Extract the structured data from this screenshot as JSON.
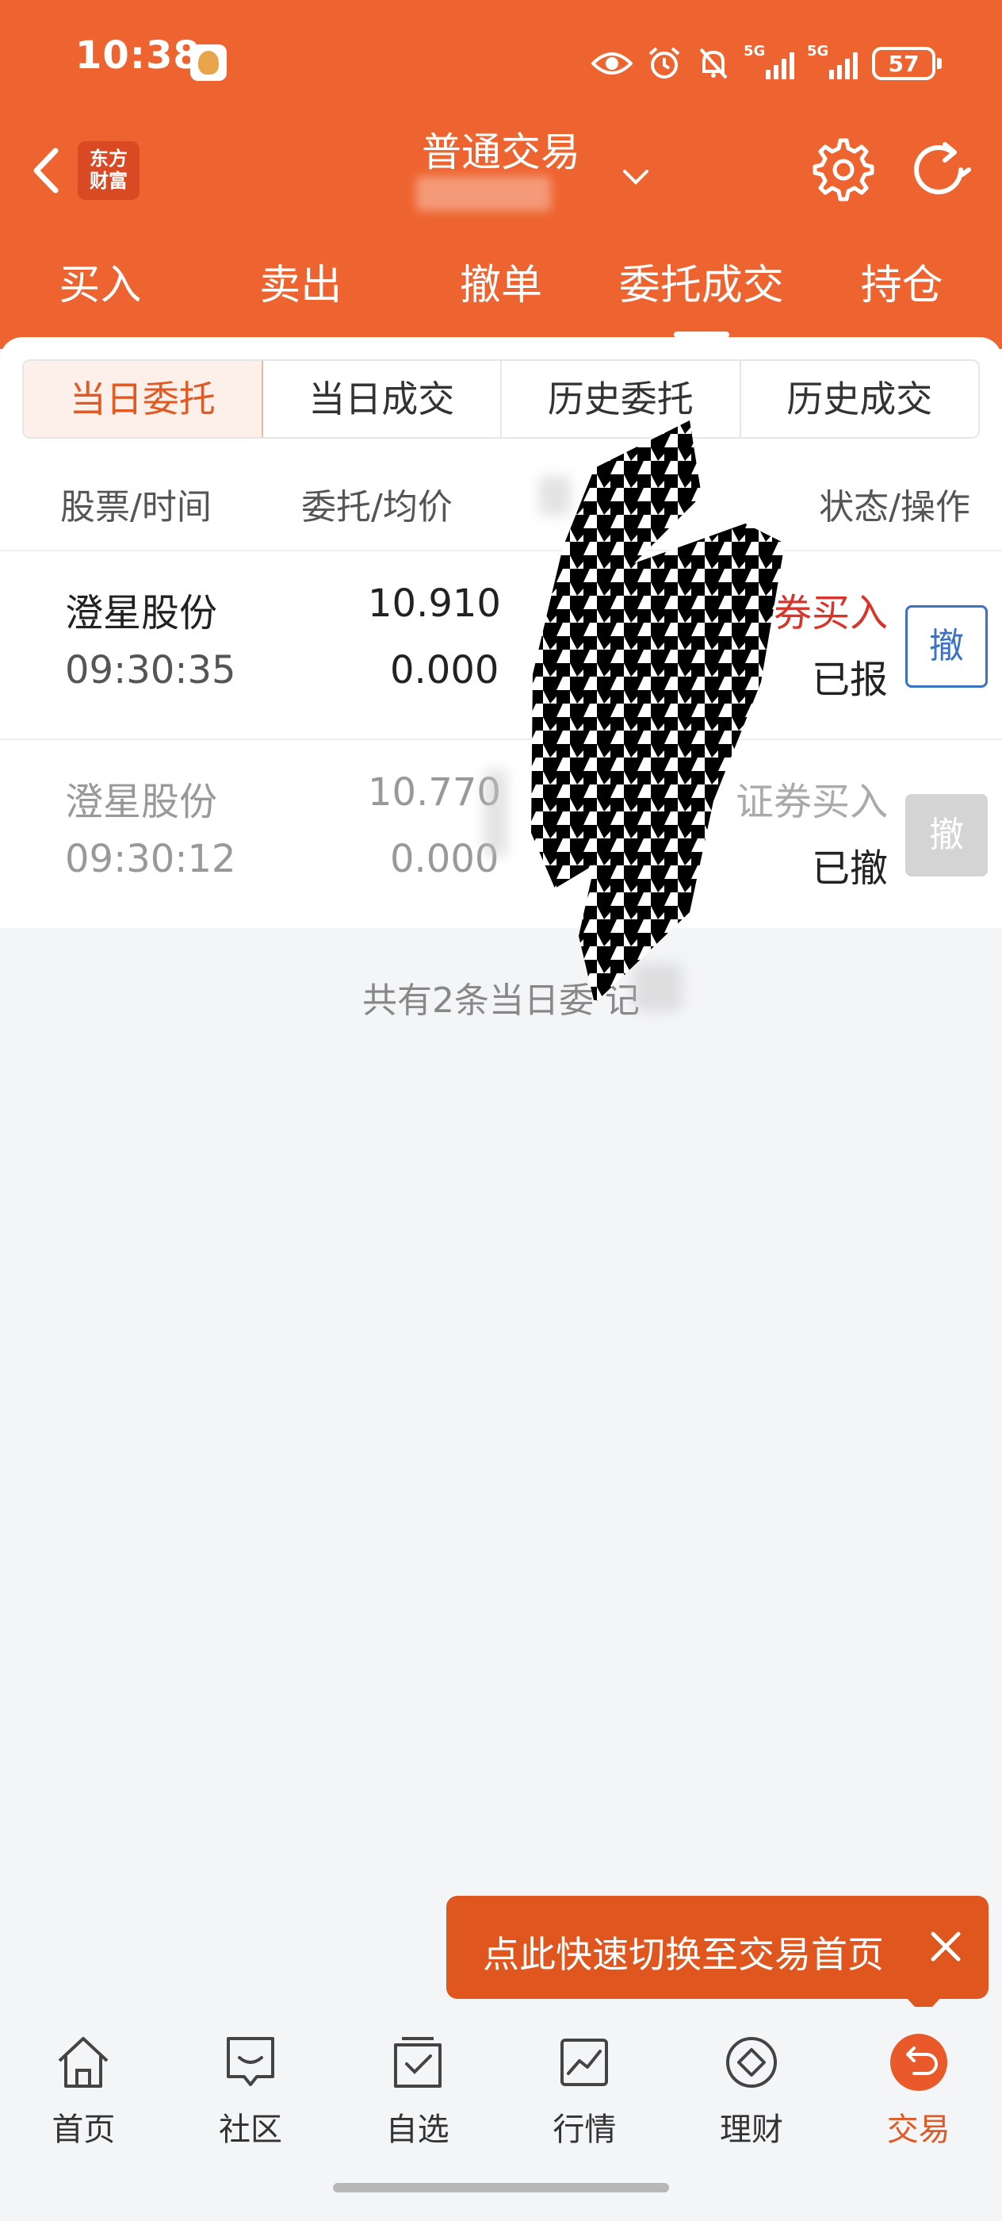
{
  "status_bar": {
    "time": "10:38",
    "network_1": "5G",
    "network_2": "5G",
    "battery": "57"
  },
  "nav": {
    "logo_line1": "东方",
    "logo_line2": "财富",
    "title": "普通交易"
  },
  "main_tabs": [
    {
      "label": "买入"
    },
    {
      "label": "卖出"
    },
    {
      "label": "撤单"
    },
    {
      "label": "委托成交"
    },
    {
      "label": "持仓"
    }
  ],
  "segments": [
    {
      "label": "当日委托"
    },
    {
      "label": "当日成交"
    },
    {
      "label": "历史委托"
    },
    {
      "label": "历史成交"
    }
  ],
  "columns": {
    "stock_time": "股票/时间",
    "price_avg": "委托/均价",
    "status_op": "状态/操作"
  },
  "orders": [
    {
      "name": "澄星股份",
      "time": "09:30:35",
      "price": "10.910",
      "avg": "0.000",
      "operation": "券买入",
      "status": "已报",
      "cancel": "撤"
    },
    {
      "name": "澄星股份",
      "time": "09:30:12",
      "price": "10.770",
      "avg": "0.000",
      "operation": "证券买入",
      "status": "已撤",
      "cancel": "撤"
    }
  ],
  "footer_note": "共有2条当日委 记",
  "tooltip": {
    "text": "点此快速切换至交易首页"
  },
  "bottom_nav": [
    {
      "label": "首页",
      "icon": "home-icon"
    },
    {
      "label": "社区",
      "icon": "community-icon"
    },
    {
      "label": "自选",
      "icon": "watchlist-icon"
    },
    {
      "label": "行情",
      "icon": "market-icon"
    },
    {
      "label": "理财",
      "icon": "finance-icon"
    },
    {
      "label": "交易",
      "icon": "trade-icon"
    }
  ],
  "colors": {
    "brand_orange": "#ee6430",
    "accent_red": "#d8342a",
    "cancel_blue": "#3a72c4"
  }
}
